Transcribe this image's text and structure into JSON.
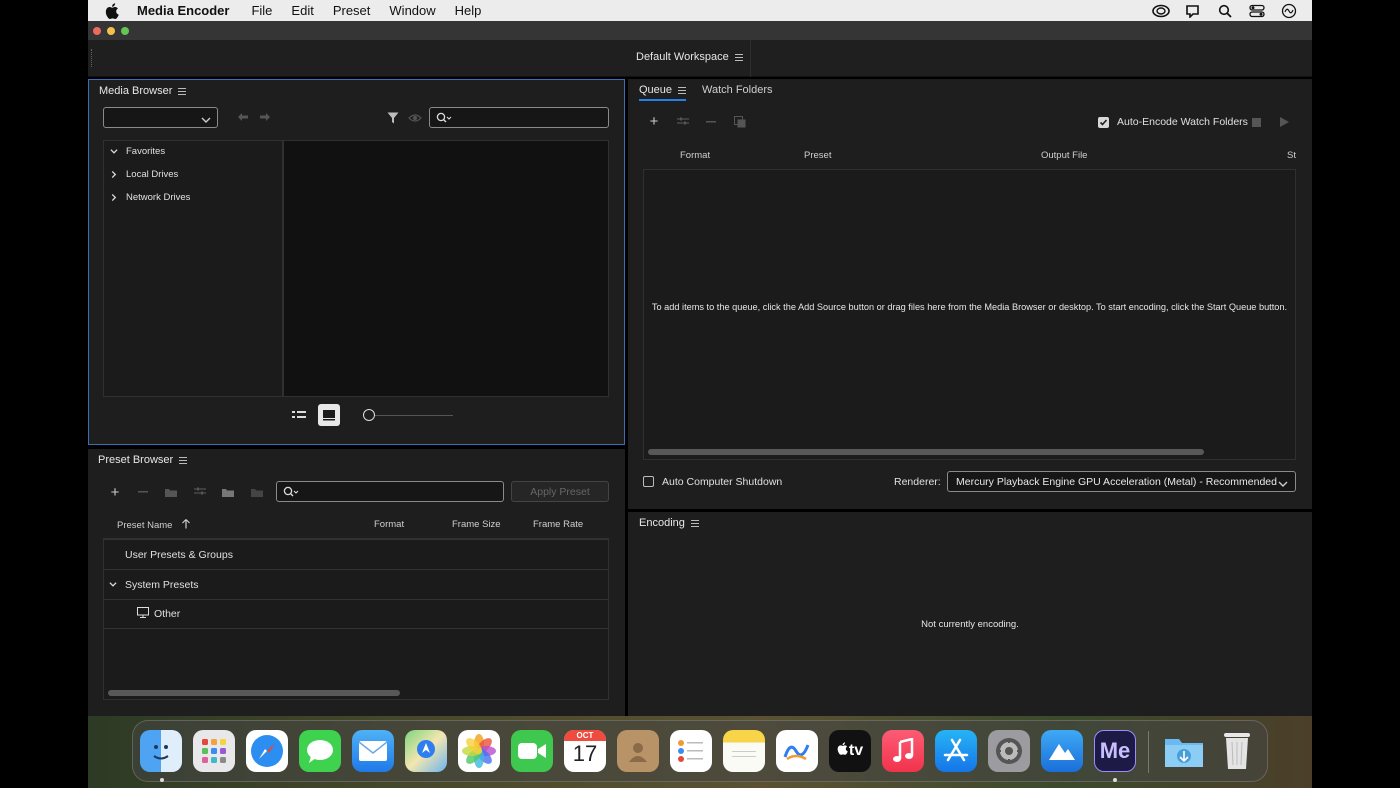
{
  "menubar": {
    "app_name": "Media Encoder",
    "menus": [
      "File",
      "Edit",
      "Preset",
      "Window",
      "Help"
    ],
    "status_icons": [
      "creative-cloud-icon",
      "notification-icon",
      "spotlight-search-icon",
      "control-center-icon",
      "siri-icon"
    ]
  },
  "workspace": {
    "label": "Default Workspace"
  },
  "media_browser": {
    "title": "Media Browser",
    "dropdown_value": "",
    "search_placeholder": "",
    "tree": [
      "Favorites",
      "Local Drives",
      "Network Drives"
    ]
  },
  "preset_browser": {
    "title": "Preset Browser",
    "apply_label": "Apply Preset",
    "search_placeholder": "",
    "columns": {
      "name": "Preset Name",
      "format": "Format",
      "frame_size": "Frame Size",
      "frame_rate": "Frame Rate"
    },
    "rows": [
      {
        "label": "User Presets & Groups"
      },
      {
        "label": "System Presets"
      },
      {
        "label": "Other"
      }
    ]
  },
  "queue": {
    "tab_queue": "Queue",
    "tab_watch": "Watch Folders",
    "auto_encode_label": "Auto-Encode Watch Folders",
    "auto_encode_checked": true,
    "columns": {
      "format": "Format",
      "preset": "Preset",
      "output": "Output File",
      "status": "St"
    },
    "empty_message": "To add items to the queue, click the Add Source button or drag files here from the Media Browser or desktop.  To start encoding, click the Start Queue button.",
    "auto_shutdown_label": "Auto Computer Shutdown",
    "auto_shutdown_checked": false,
    "renderer_label": "Renderer:",
    "renderer_value": "Mercury Playback Engine GPU Acceleration (Metal) - Recommended"
  },
  "encoding": {
    "title": "Encoding",
    "status": "Not currently encoding."
  },
  "dock": {
    "calendar_month": "OCT",
    "calendar_day": "17",
    "tv_label": "tv",
    "me_label": "Me",
    "apps": [
      "Finder",
      "Launchpad",
      "Safari",
      "Messages",
      "Mail",
      "Maps",
      "Photos",
      "FaceTime",
      "Calendar",
      "Contacts",
      "Reminders",
      "Notes",
      "Freeform",
      "TV",
      "Music",
      "App Store",
      "System Settings",
      "Altitude",
      "Media Encoder",
      "Downloads",
      "Trash"
    ]
  },
  "colors": {
    "panel_bg": "#1e1e1e",
    "active_border": "#3a6fb8",
    "accent_blue": "#2680eb"
  }
}
